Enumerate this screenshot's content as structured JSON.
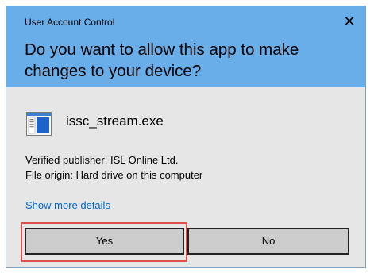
{
  "dialog": {
    "title": "User Account Control",
    "close_glyph": "✕",
    "question": "Do you want to allow this app to make changes to your device?",
    "app_name": "issc_stream.exe",
    "publisher": "Verified publisher: ISL Online Ltd.",
    "origin": "File origin: Hard drive on this computer",
    "show_more": "Show more details",
    "yes_label": "Yes",
    "no_label": "No"
  },
  "colors": {
    "header": "#6aaee9",
    "body": "#e6e6e6",
    "link": "#0066cc",
    "highlight": "#e0504a"
  },
  "icons": {
    "app": "application-window-icon",
    "close": "close-icon"
  }
}
